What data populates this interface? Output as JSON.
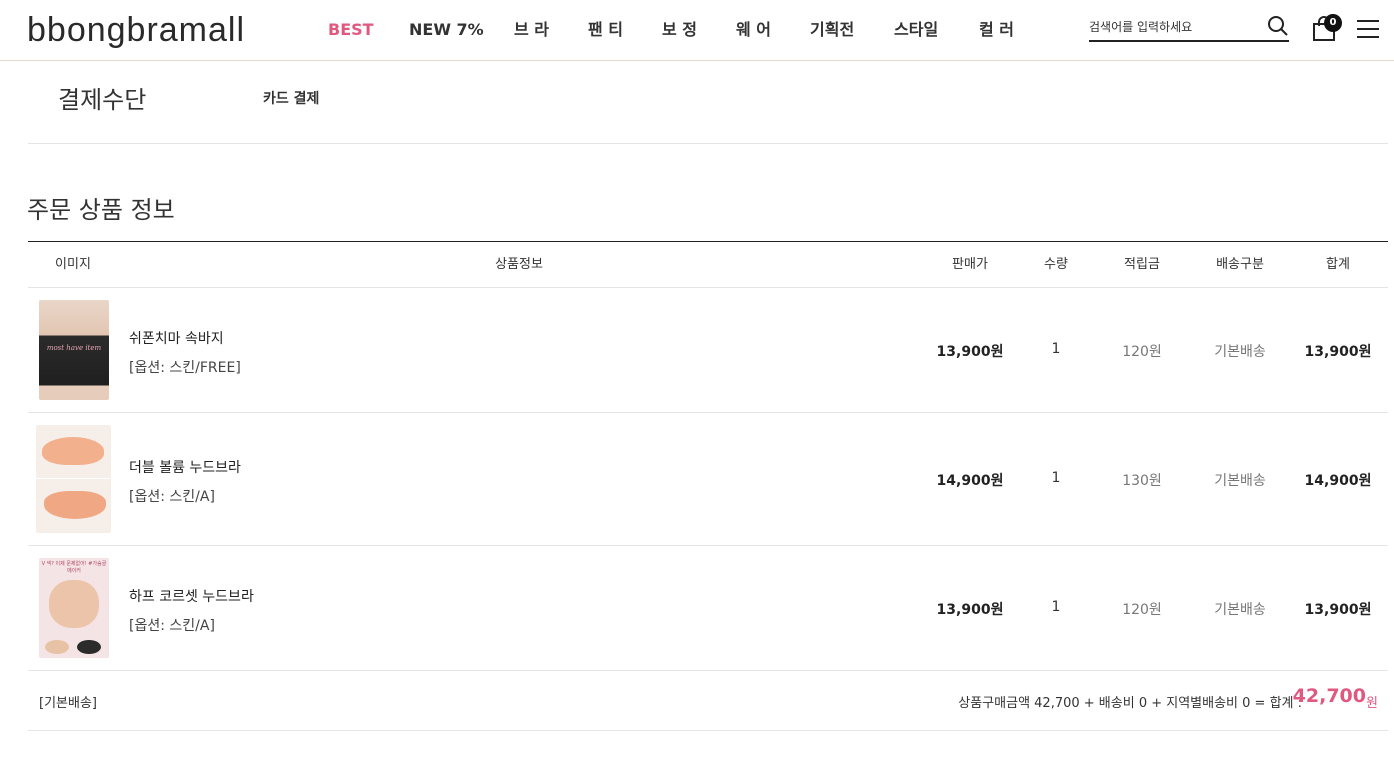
{
  "header": {
    "logo": "bbongbramall",
    "nav": [
      "BEST",
      "NEW 7%",
      "브 라",
      "팬 티",
      "보 정",
      "웨 어",
      "기획전",
      "스타일",
      "컬 러"
    ],
    "search_placeholder": "검색어를 입력하세요",
    "cart_count": "0"
  },
  "payment": {
    "label": "결제수단",
    "value": "카드 결제"
  },
  "order": {
    "title": "주문 상품 정보",
    "columns": {
      "image": "이미지",
      "info": "상품정보",
      "price": "판매가",
      "qty": "수량",
      "points": "적립금",
      "shipping": "배송구분",
      "total": "합계"
    },
    "items": [
      {
        "name": "쉬폰치마 속바지",
        "option": "[옵션: 스킨/FREE]",
        "price": "13,900원",
        "qty": "1",
        "points": "120원",
        "shipping": "기본배송",
        "total": "13,900원",
        "thumb_text": "most have item"
      },
      {
        "name": "더블 볼륨 누드브라",
        "option": "[옵션: 스킨/A]",
        "price": "14,900원",
        "qty": "1",
        "points": "130원",
        "shipping": "기본배송",
        "total": "14,900원",
        "thumb_text": ""
      },
      {
        "name": "하프 코르셋 누드브라",
        "option": "[옵션: 스킨/A]",
        "price": "13,900원",
        "qty": "1",
        "points": "120원",
        "shipping": "기본배송",
        "total": "13,900원",
        "thumb_text": "V 넥? 이제 문제없어! #가슴골메이커"
      }
    ],
    "summary": {
      "ship_type": "[기본배송]",
      "text": "상품구매금액 42,700 + 배송비 0 + 지역별배송비 0 = 합계 :",
      "total": "42,700",
      "unit": "원"
    }
  },
  "colors": {
    "accent": "#e0587f",
    "border": "#e5e5e5"
  }
}
